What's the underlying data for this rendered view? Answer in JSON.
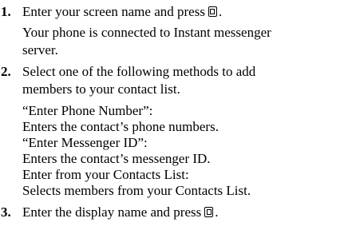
{
  "steps": [
    {
      "number": "1.",
      "instruction_text": "Enter your screen name and press",
      "instruction_end": ".",
      "key_icon": "ok-key-icon",
      "result_lines": [
        "Your phone is connected to Instant messenger",
        "server."
      ]
    },
    {
      "number": "2.",
      "instruction_lines": [
        "Select one of the following methods to add",
        "members to your contact list."
      ],
      "options": [
        {
          "title": "“Enter Phone Number”:",
          "description": "Enters the contact’s phone numbers."
        },
        {
          "title": "“Enter Messenger ID”:",
          "description": "Enters the contact’s messenger ID."
        },
        {
          "title": "Enter from your Contacts List:",
          "description": "Selects members from your Contacts List."
        }
      ]
    },
    {
      "number": "3.",
      "instruction_text": "Enter the display name and press",
      "instruction_end": ".",
      "key_icon": "ok-key-icon"
    }
  ]
}
